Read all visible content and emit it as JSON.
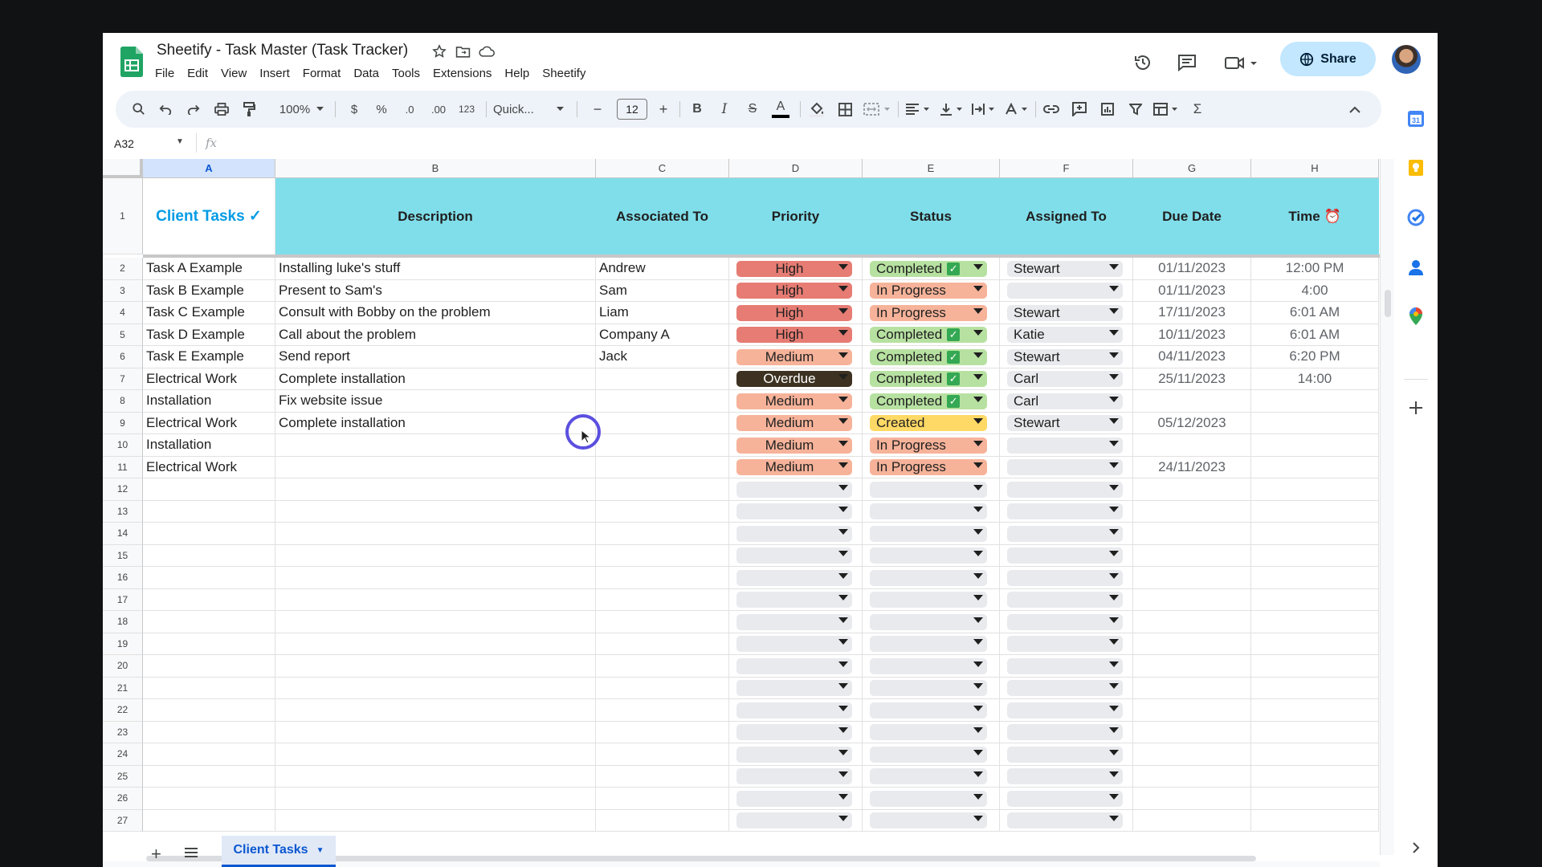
{
  "app": {
    "doc_title": "Sheetify - Task Master (Task Tracker)",
    "menu": [
      "File",
      "Edit",
      "View",
      "Insert",
      "Format",
      "Data",
      "Tools",
      "Extensions",
      "Help",
      "Sheetify"
    ],
    "share_label": "Share"
  },
  "toolbar": {
    "zoom": "100%",
    "currency": "$",
    "percent": "%",
    "dec_decrease": ".0",
    "dec_increase": ".00",
    "number_format": "123",
    "font": "Quick...",
    "font_size": "12",
    "minus": "−",
    "plus": "+",
    "bold": "B",
    "italic": "I",
    "strike": "S",
    "text_color": "A",
    "sigma": "Σ"
  },
  "formula_bar": {
    "name_box": "A32",
    "fx": "fx"
  },
  "grid": {
    "columns": [
      "A",
      "B",
      "C",
      "D",
      "E",
      "F",
      "G",
      "H"
    ],
    "selected_column": "A",
    "header_row_number": "1",
    "headers": {
      "a": "Client Tasks ✓",
      "b": "Description",
      "c": "Associated To",
      "d": "Priority",
      "e": "Status",
      "f": "Assigned To",
      "g": "Due Date",
      "h": "Time ⏰"
    },
    "rows": [
      {
        "num": "2",
        "task": "Task A Example",
        "desc": "Installing luke's stuff",
        "assoc": "Andrew",
        "priority": "High",
        "status": "Completed",
        "assigned": "Stewart",
        "due": "01/11/2023",
        "time": "12:00 PM"
      },
      {
        "num": "3",
        "task": "Task B Example",
        "desc": "Present to Sam's",
        "assoc": "Sam",
        "priority": "High",
        "status": "In Progress",
        "assigned": "",
        "due": "01/11/2023",
        "time": "4:00"
      },
      {
        "num": "4",
        "task": "Task C Example",
        "desc": "Consult with Bobby on the problem",
        "assoc": "Liam",
        "priority": "High",
        "status": "In Progress",
        "assigned": "Stewart",
        "due": "17/11/2023",
        "time": "6:01 AM"
      },
      {
        "num": "5",
        "task": "Task D Example",
        "desc": "Call about the problem",
        "assoc": "Company A",
        "priority": "High",
        "status": "Completed",
        "assigned": "Katie",
        "due": "10/11/2023",
        "time": "6:01 AM"
      },
      {
        "num": "6",
        "task": "Task E Example",
        "desc": "Send report",
        "assoc": "Jack",
        "priority": "Medium",
        "status": "Completed",
        "assigned": "Stewart",
        "due": "04/11/2023",
        "time": "6:20 PM"
      },
      {
        "num": "7",
        "task": "Electrical Work",
        "desc": "Complete installation",
        "assoc": "",
        "priority": "Overdue",
        "status": "Completed",
        "assigned": "Carl",
        "due": "25/11/2023",
        "time": "14:00"
      },
      {
        "num": "8",
        "task": "Installation",
        "desc": "Fix website issue",
        "assoc": "",
        "priority": "Medium",
        "status": "Completed",
        "assigned": "Carl",
        "due": "",
        "time": ""
      },
      {
        "num": "9",
        "task": "Electrical Work",
        "desc": "Complete installation",
        "assoc": "",
        "priority": "Medium",
        "status": "Created",
        "assigned": "Stewart",
        "due": "05/12/2023",
        "time": ""
      },
      {
        "num": "10",
        "task": "Installation",
        "desc": "",
        "assoc": "",
        "priority": "Medium",
        "status": "In Progress",
        "assigned": "",
        "due": "",
        "time": ""
      },
      {
        "num": "11",
        "task": "Electrical Work",
        "desc": "",
        "assoc": "",
        "priority": "Medium",
        "status": "In Progress",
        "assigned": "",
        "due": "24/11/2023",
        "time": ""
      }
    ],
    "empty_row_numbers": [
      "12",
      "13",
      "14",
      "15",
      "16",
      "17",
      "18",
      "19",
      "20",
      "21",
      "22",
      "23",
      "24",
      "25",
      "26",
      "27"
    ]
  },
  "colors": {
    "header_fill": "#80deea",
    "client_tasks_title": "#039be5",
    "priority": {
      "High": "#e67c73",
      "Medium": "#f6b39a",
      "Overdue": "#3d3221"
    },
    "status": {
      "Completed": "#b7e1a1",
      "In Progress": "#f6b39a",
      "Created": "#ffd966"
    },
    "empty_dropdown": "#e8eaed",
    "assigned_fill": "#e8eaed"
  },
  "sheet_tabs": {
    "active": "Client Tasks"
  }
}
